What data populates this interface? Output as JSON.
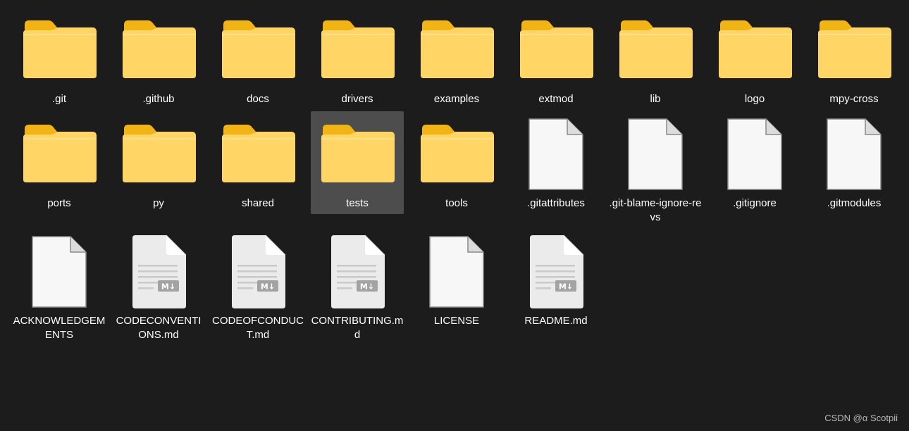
{
  "colors": {
    "background": "#1c1c1c",
    "selection": "#4d4d4d",
    "folder_front": "#ffd566",
    "folder_back": "#f2b315",
    "file_page": "#f7f7f7"
  },
  "items": [
    {
      "name": ".git",
      "type": "folder",
      "icon": "folder-icon"
    },
    {
      "name": ".github",
      "type": "folder",
      "icon": "folder-icon"
    },
    {
      "name": "docs",
      "type": "folder",
      "icon": "folder-icon"
    },
    {
      "name": "drivers",
      "type": "folder",
      "icon": "folder-icon"
    },
    {
      "name": "examples",
      "type": "folder",
      "icon": "folder-icon"
    },
    {
      "name": "extmod",
      "type": "folder",
      "icon": "folder-icon"
    },
    {
      "name": "lib",
      "type": "folder",
      "icon": "folder-icon"
    },
    {
      "name": "logo",
      "type": "folder",
      "icon": "folder-icon"
    },
    {
      "name": "mpy-cross",
      "type": "folder",
      "icon": "folder-icon"
    },
    {
      "name": "ports",
      "type": "folder",
      "icon": "folder-icon"
    },
    {
      "name": "py",
      "type": "folder",
      "icon": "folder-icon"
    },
    {
      "name": "shared",
      "type": "folder",
      "icon": "folder-icon"
    },
    {
      "name": "tests",
      "type": "folder",
      "icon": "folder-icon",
      "selected": true
    },
    {
      "name": "tools",
      "type": "folder",
      "icon": "folder-icon"
    },
    {
      "name": ".gitattributes",
      "type": "file",
      "icon": "file-icon"
    },
    {
      "name": ".git-blame-ignore-revs",
      "type": "file",
      "icon": "file-icon"
    },
    {
      "name": ".gitignore",
      "type": "file",
      "icon": "file-icon"
    },
    {
      "name": ".gitmodules",
      "type": "file",
      "icon": "file-icon"
    },
    {
      "name": "ACKNOWLEDGEMENTS",
      "type": "file",
      "icon": "file-icon"
    },
    {
      "name": "CODECONVENTIONS.md",
      "type": "markdown",
      "icon": "markdown-file-icon"
    },
    {
      "name": "CODEOFCONDUCT.md",
      "type": "markdown",
      "icon": "markdown-file-icon"
    },
    {
      "name": "CONTRIBUTING.md",
      "type": "markdown",
      "icon": "markdown-file-icon"
    },
    {
      "name": "LICENSE",
      "type": "file",
      "icon": "file-icon"
    },
    {
      "name": "README.md",
      "type": "markdown",
      "icon": "markdown-file-icon"
    }
  ],
  "markdown_badge": "M↓",
  "watermark": "CSDN @α Scotpii"
}
